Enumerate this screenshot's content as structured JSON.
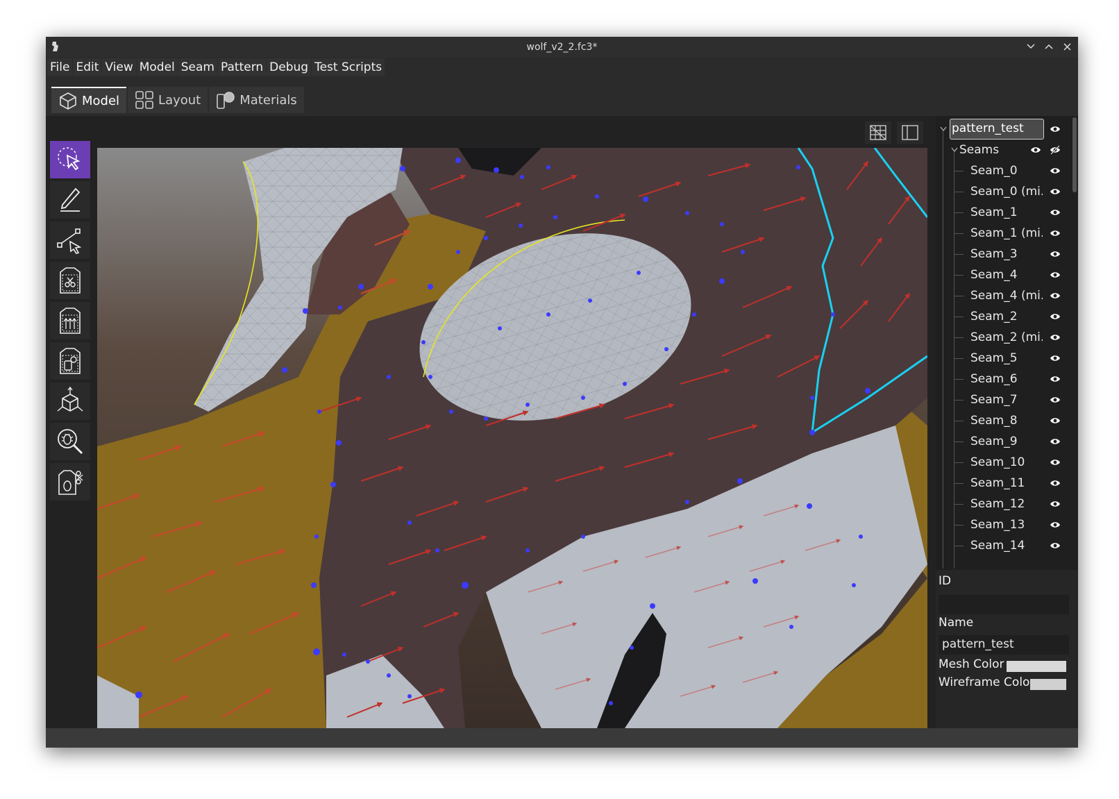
{
  "window": {
    "title": "wolf_v2_2.fc3*"
  },
  "menu": [
    "File",
    "Edit",
    "View",
    "Model",
    "Seam",
    "Pattern",
    "Debug",
    "Test Scripts"
  ],
  "tabs": [
    {
      "label": "Model",
      "icon": "cube-icon",
      "active": true
    },
    {
      "label": "Layout",
      "icon": "grid-icon",
      "active": false
    },
    {
      "label": "Materials",
      "icon": "materials-icon",
      "active": false
    }
  ],
  "view_buttons": [
    "mesh-view-icon",
    "panel-toggle-icon"
  ],
  "tools": [
    {
      "name": "select-tool",
      "icon": "select-cursor-icon",
      "active": true
    },
    {
      "name": "draw-tool",
      "icon": "pencil-icon"
    },
    {
      "name": "edge-select-tool",
      "icon": "node-path-icon"
    },
    {
      "name": "cut-pattern-tool",
      "icon": "pattern-cut-icon"
    },
    {
      "name": "pattern-grain-tool",
      "icon": "pattern-arrows-icon"
    },
    {
      "name": "pattern-piece-tool",
      "icon": "pattern-piece-icon"
    },
    {
      "name": "transform-tool",
      "icon": "transform-cube-icon"
    },
    {
      "name": "debug-inspect-tool",
      "icon": "bug-search-icon"
    },
    {
      "name": "debug-pattern-tool",
      "icon": "pattern-bug-icon"
    }
  ],
  "tree": {
    "root": "pattern_test",
    "group": "Seams",
    "items": [
      "Seam_0",
      "Seam_0 (mi...",
      "Seam_1",
      "Seam_1 (mi...",
      "Seam_3",
      "Seam_4",
      "Seam_4 (mi...",
      "Seam_2",
      "Seam_2 (mi...",
      "Seam_5",
      "Seam_6",
      "Seam_7",
      "Seam_8",
      "Seam_9",
      "Seam_10",
      "Seam_11",
      "Seam_12",
      "Seam_13",
      "Seam_14"
    ]
  },
  "properties": {
    "id_label": "ID",
    "id_value": "",
    "name_label": "Name",
    "name_value": "pattern_test",
    "mesh_color_label": "Mesh Color",
    "wireframe_color_label": "Wireframe Color",
    "mesh_color": "#d8d8d8",
    "wireframe_color": "#d0d0d0"
  },
  "colors": {
    "accent": "#6b3fb3",
    "seam_cyan": "#1ad0f0",
    "arrow_red": "#c0302a",
    "mesh_gold": "#8a6a1e",
    "mesh_brown": "#4a3a3c",
    "mesh_grey": "#b8bcc4"
  }
}
